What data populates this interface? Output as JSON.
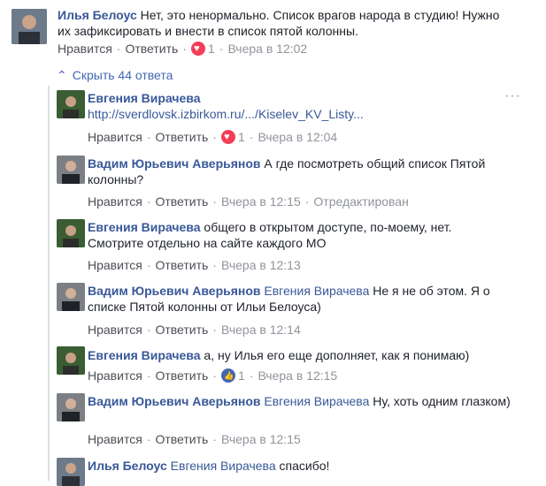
{
  "top_comment": {
    "author": "Илья Белоус",
    "text": "Нет, это ненормально. Список врагов народа в студию! Нужно их зафиксировать и внести в список пятой колонны.",
    "like_label": "Нравится",
    "reply_label": "Ответить",
    "reaction_count": "1",
    "time": "Вчера в 12:02"
  },
  "hide_replies": "Скрыть 44 ответа",
  "more_icon": "···",
  "replies": [
    {
      "author": "Евгения Вирачева",
      "link": "http://sverdlovsk.izbirkom.ru/.../Kiselev_KV_Listy...",
      "like_label": "Нравится",
      "reply_label": "Ответить",
      "reaction_count": "1",
      "time": "Вчера в 12:04"
    },
    {
      "author": "Вадим Юрьевич Аверьянов",
      "text": "А где посмотреть общий список Пятой колонны?",
      "like_label": "Нравится",
      "reply_label": "Ответить",
      "time": "Вчера в 12:15",
      "edited": "Отредактирован"
    },
    {
      "author": "Евгения Вирачева",
      "text": "общего в открытом доступе, по-моему, нет. Смотрите отдельно на сайте каждого МО",
      "like_label": "Нравится",
      "reply_label": "Ответить",
      "time": "Вчера в 12:13"
    },
    {
      "author": "Вадим Юрьевич Аверьянов",
      "mention": "Евгения Вирачева",
      "text": "Не я не об этом. Я о списке Пятой колонны от Ильи Белоуса)",
      "like_label": "Нравится",
      "reply_label": "Ответить",
      "time": "Вчера в 12:14"
    },
    {
      "author": "Евгения Вирачева",
      "text": "а, ну Илья его еще дополняет, как я понимаю)",
      "like_label": "Нравится",
      "reply_label": "Ответить",
      "reaction_count": "1",
      "time": "Вчера в 12:15"
    },
    {
      "author": "Вадим Юрьевич Аверьянов",
      "mention": "Евгения Вирачева",
      "text": "Ну, хоть одним глазком)",
      "like_label": "Нравится",
      "reply_label": "Ответить",
      "time": "Вчера в 12:15"
    },
    {
      "author": "Илья Белоус",
      "mention": "Евгения Вирачева",
      "text": "спасибо!"
    }
  ]
}
